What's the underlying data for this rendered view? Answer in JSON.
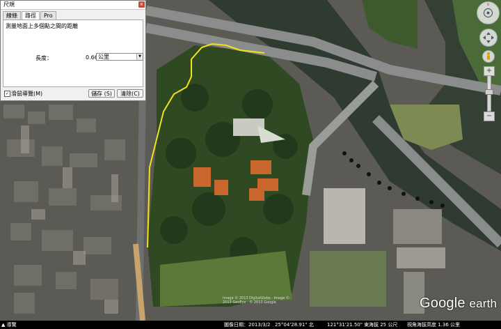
{
  "dialog": {
    "title": "尺規",
    "close_glyph": "x",
    "tabs": [
      "線條",
      "路徑",
      "Pro"
    ],
    "description": "測量地面上多個點之間的距離",
    "length_label": "長度：",
    "length_value": "0.66",
    "unit_selected": "公里",
    "mouse_nav_label": "滑鼠導覽(M)",
    "mouse_nav_checked": true,
    "save_button": "儲存 (S)",
    "clear_button": "清除(C)"
  },
  "map": {
    "logo_google": "Google",
    "logo_earth": "earth",
    "copyright": "Image © 2013 DigitalGlobe · Image © 2013 GeoEye · © 2013 Google"
  },
  "nav": {
    "zoom_in": "+",
    "zoom_out": "−"
  },
  "statusbar": {
    "nav_button": "導覽",
    "imagery_date": "圖像日期：2013/3/2",
    "lat": "25°04'28.91\" 北",
    "lon": "121°31'21.50\" 東",
    "elev": "海拔 25 公尺",
    "eye_alt": "視角海拔高度 1.36 公里"
  },
  "colors": {
    "path_line": "#f2e21a",
    "water": "#3d4a38",
    "park": "#3b5a2a",
    "road": "#6e7070"
  }
}
